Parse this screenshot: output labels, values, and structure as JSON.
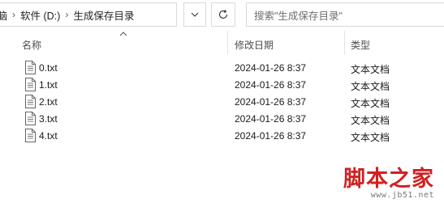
{
  "breadcrumb": {
    "truncated": "此电脑",
    "items": [
      "软件 (D:)",
      "生成保存目录"
    ]
  },
  "search": {
    "placeholder": "搜索\"生成保存目录\""
  },
  "columns": {
    "name": "名称",
    "date": "修改日期",
    "type": "类型"
  },
  "files": [
    {
      "name": "0.txt",
      "date": "2024-01-26 8:37",
      "type": "文本文档"
    },
    {
      "name": "1.txt",
      "date": "2024-01-26 8:37",
      "type": "文本文档"
    },
    {
      "name": "2.txt",
      "date": "2024-01-26 8:37",
      "type": "文本文档"
    },
    {
      "name": "3.txt",
      "date": "2024-01-26 8:37",
      "type": "文本文档"
    },
    {
      "name": "4.txt",
      "date": "2024-01-26 8:37",
      "type": "文本文档"
    }
  ],
  "watermark": {
    "title": "脚本之家",
    "url": "www.jb51.net"
  },
  "colors": {
    "border": "#dadada",
    "watermark_red": "#d22020"
  }
}
